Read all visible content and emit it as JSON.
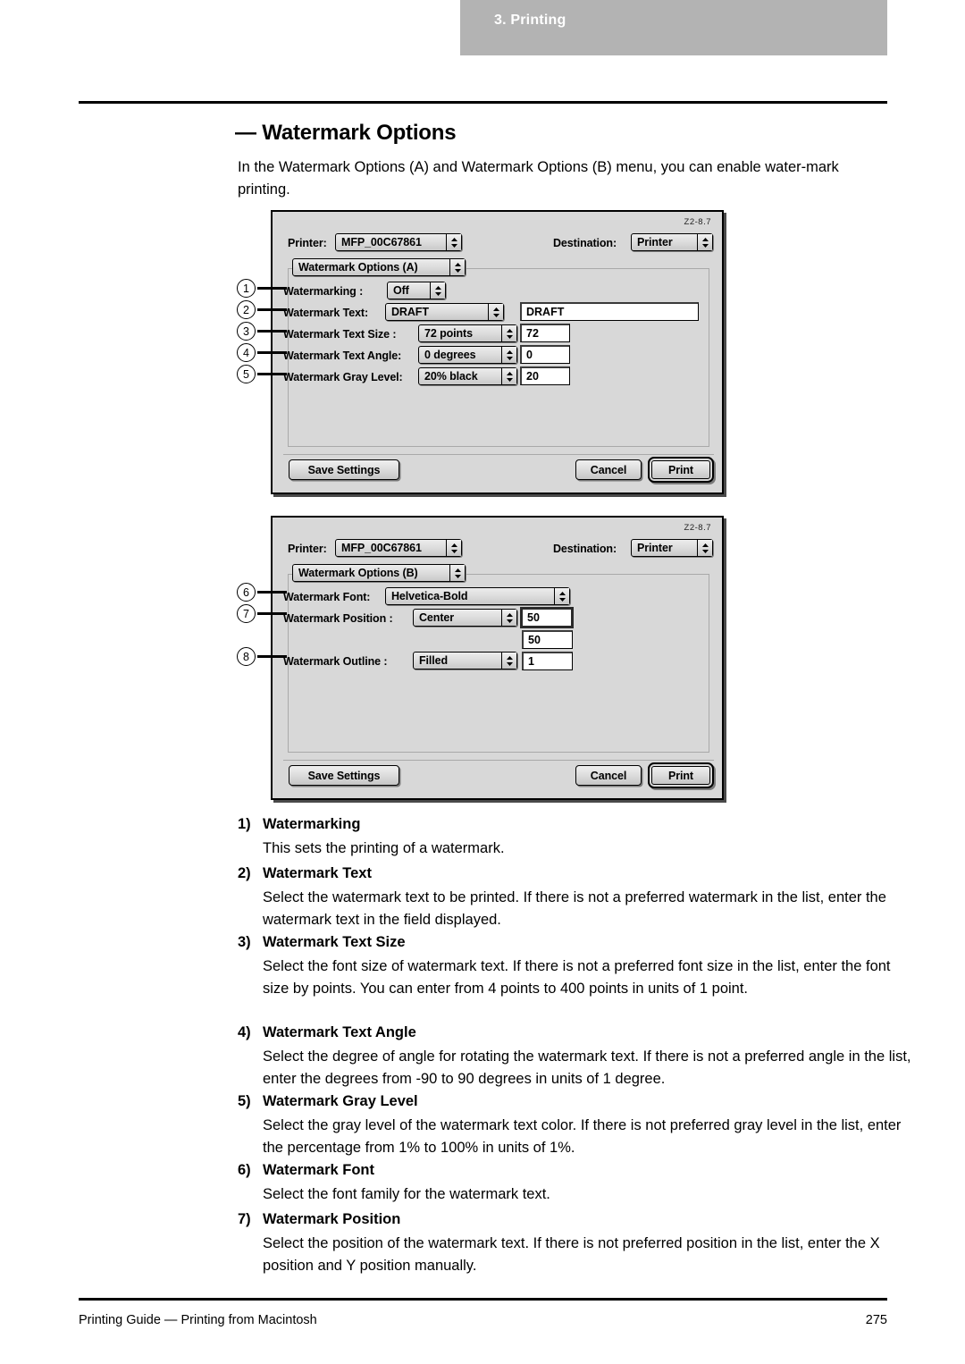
{
  "header": {
    "running_head": "3. Printing"
  },
  "section": {
    "heading": "— Watermark Options",
    "intro": "In the Watermark Options (A) and Watermark Options (B) menu, you can enable water-mark printing."
  },
  "dialog_a": {
    "code": "Z2-8.7",
    "printer_label": "Printer:",
    "printer_value": "MFP_00C67861",
    "destination_label": "Destination:",
    "destination_value": "Printer",
    "panel_popup": "Watermark Options (A)",
    "rows": [
      {
        "callout": "1",
        "label": "Watermarking  :",
        "popup": "Off",
        "field": null
      },
      {
        "callout": "2",
        "label": "Watermark Text:",
        "popup": "DRAFT",
        "field": "DRAFT"
      },
      {
        "callout": "3",
        "label": "Watermark Text Size  :",
        "popup": "72 points",
        "field": "72"
      },
      {
        "callout": "4",
        "label": "Watermark Text Angle:",
        "popup": "0 degrees",
        "field": "0"
      },
      {
        "callout": "5",
        "label": "Watermark Gray Level:",
        "popup": "20% black",
        "field": "20"
      }
    ],
    "save_label": "Save Settings",
    "cancel_label": "Cancel",
    "print_label": "Print"
  },
  "dialog_b": {
    "code": "Z2-8.7",
    "printer_label": "Printer:",
    "printer_value": "MFP_00C67861",
    "destination_label": "Destination:",
    "destination_value": "Printer",
    "panel_popup": "Watermark Options (B)",
    "rows": [
      {
        "callout": "6",
        "label": "Watermark Font:",
        "popup": "Helvetica-Bold",
        "field": null
      },
      {
        "callout": "7",
        "label": "Watermark Position   :",
        "popup": "Center",
        "field": "50",
        "field2": "50"
      },
      {
        "callout": "8",
        "label": "Watermark Outline    :",
        "popup": "Filled",
        "field": "1"
      }
    ],
    "save_label": "Save Settings",
    "cancel_label": "Cancel",
    "print_label": "Print"
  },
  "items": [
    {
      "num": "1)",
      "title": "Watermarking",
      "body": "This sets the printing of a watermark."
    },
    {
      "num": "2)",
      "title": "Watermark Text",
      "body": "Select the watermark text to be printed.   If there is not a preferred watermark in the list, enter the watermark text in the field displayed."
    },
    {
      "num": "3)",
      "title": "Watermark Text Size",
      "body": "Select the font size of watermark text.  If there is not a preferred font size in the list, enter the font size by points.  You can enter from 4 points to 400 points in units of 1 point."
    },
    {
      "num": "4)",
      "title": "Watermark Text Angle",
      "body": "Select the degree of angle for rotating the watermark text. If there is not a preferred angle in the list, enter the degrees from -90 to 90 degrees in units of 1 degree."
    },
    {
      "num": "5)",
      "title": "Watermark Gray Level",
      "body": "Select the gray level of the watermark text color.  If there is not preferred gray level in the list, enter the percentage from 1% to 100% in units of 1%."
    },
    {
      "num": "6)",
      "title": "Watermark Font",
      "body": "Select the font family for the watermark text."
    },
    {
      "num": "7)",
      "title": "Watermark Position",
      "body": "Select the position of the watermark text.  If there is not preferred position in the list, enter the X position and Y position manually."
    }
  ],
  "footer": {
    "left": "Printing Guide — Printing from Macintosh",
    "page": "275"
  }
}
